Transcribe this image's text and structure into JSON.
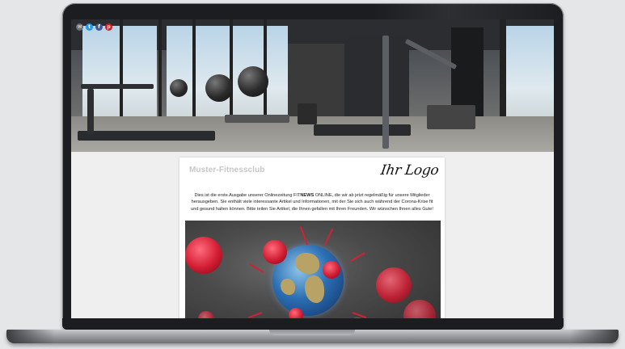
{
  "social": {
    "icons": [
      {
        "name": "email-icon",
        "glyph": "✉",
        "color": "#6f6f6f"
      },
      {
        "name": "twitter-icon",
        "glyph": "t",
        "color": "#1d9bf0"
      },
      {
        "name": "facebook-icon",
        "glyph": "f",
        "color": "#3b5998"
      },
      {
        "name": "pinterest-icon",
        "glyph": "p",
        "color": "#cb2027"
      }
    ]
  },
  "newsletter": {
    "club_name": "Muster-Fitnessclub",
    "logo_text": "Ihr Logo",
    "intro_before": "Dies ist die erste Ausgabe unserer Onlinezeitung FIT",
    "intro_bold": "NEWS",
    "intro_after": " ONLINE, die wir ab jetzt regelmäßig für unsere Mitglieder herausgeben. Sie enthält viele interessante Artikel und Informationen, mit der Sie sich auch während der Corona-Krise fit und gesund halten können. Bitte teilen Sie Artikel, die Ihnen gefallen mit Ihren Freunden. Wir wünschen Ihnen alles Gute!"
  }
}
